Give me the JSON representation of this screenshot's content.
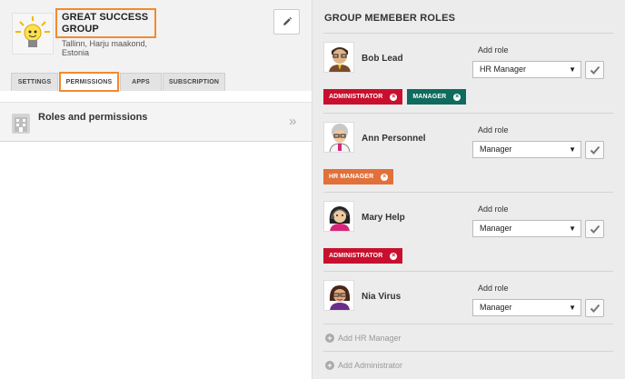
{
  "group": {
    "title_line1": "GREAT SUCCESS",
    "title_line2": "GROUP",
    "location_line1": "Tallinn, Harju maakond,",
    "location_line2": "Estonia",
    "logo_icon": "lightbulb-icon",
    "edit_icon": "pencil-icon"
  },
  "tabs": [
    {
      "label": "SETTINGS",
      "active": false
    },
    {
      "label": "PERMISSIONS",
      "active": true
    },
    {
      "label": "APPS",
      "active": false
    },
    {
      "label": "SUBSCRIPTION",
      "active": false
    }
  ],
  "roles_section": {
    "label": "Roles and permissions",
    "icon": "building-icon",
    "chevron": "»"
  },
  "right_panel": {
    "title": "GROUP MEMEBER ROLES",
    "add_role_label": "Add role",
    "members": [
      {
        "name": "Bob Lead",
        "selected_role": "HR Manager",
        "badges": [
          {
            "label": "ADMINISTRATOR",
            "color": "#c8102e"
          },
          {
            "label": "MANAGER",
            "color": "#0e6b5d"
          }
        ]
      },
      {
        "name": "Ann Personnel",
        "selected_role": "Manager",
        "badges": [
          {
            "label": "HR MANAGER",
            "color": "#e2703a"
          }
        ]
      },
      {
        "name": "Mary Help",
        "selected_role": "Manager",
        "badges": [
          {
            "label": "ADMINISTRATOR",
            "color": "#c8102e"
          }
        ]
      },
      {
        "name": "Nia Virus",
        "selected_role": "Manager",
        "badges": []
      }
    ],
    "add_hr_manager": "Add HR Manager",
    "add_administrator": "Add Administrator"
  },
  "colors": {
    "highlight": "#f28a2e",
    "panel_bg": "#ececec"
  }
}
